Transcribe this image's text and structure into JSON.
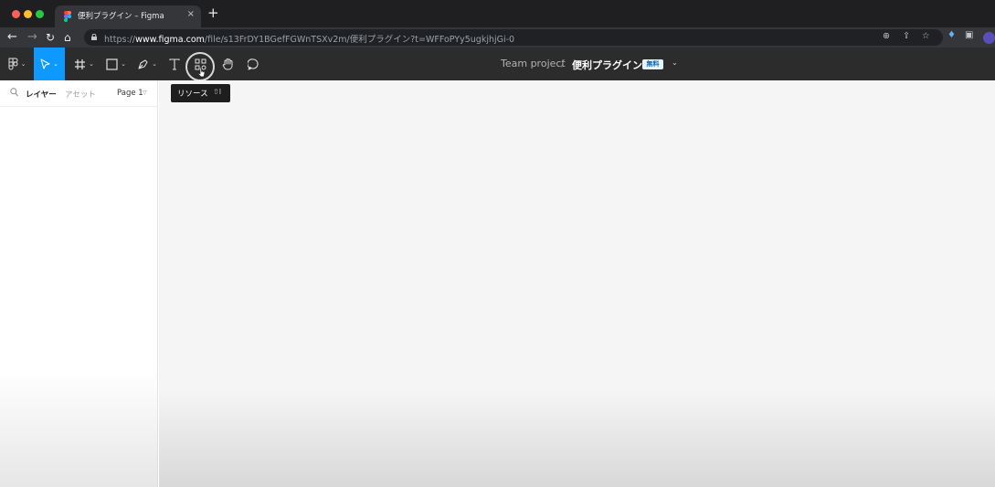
{
  "browser": {
    "tab_title": "便利プラグイン – Figma",
    "tab_close": "×",
    "new_tab": "+",
    "url_prefix": "https://",
    "url_host": "www.figma.com",
    "url_path": "/file/s13FrDY1BGefFGWnTSXv2m/便利プラグイン?t=WFFoPYy5ugkjhjGi-0"
  },
  "toolbar": {
    "project_name": "Team project",
    "separator": "/",
    "file_name": "便利プラグイン",
    "plan_badge": "無料",
    "tooltip_label": "リソース",
    "tooltip_shortcut": "⇧I"
  },
  "left_panel": {
    "tabs": [
      "レイヤー",
      "アセット"
    ],
    "page_selector": "Page 1"
  },
  "colors": {
    "accent": "#0d99ff",
    "toolbar_bg": "#2c2c2c",
    "canvas_bg": "#f5f5f5"
  }
}
